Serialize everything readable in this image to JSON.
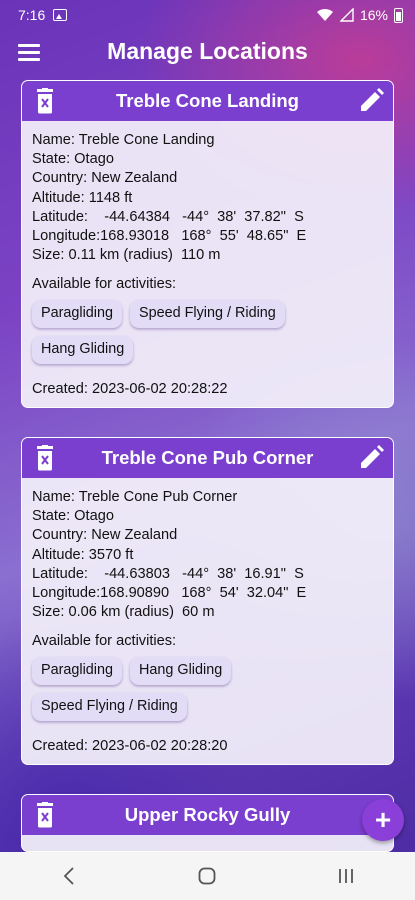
{
  "status_bar": {
    "time": "7:16",
    "battery": "16%"
  },
  "app_bar": {
    "title": "Manage Locations"
  },
  "locations": [
    {
      "title": "Treble Cone Landing",
      "name_line": "Name: Treble Cone Landing",
      "state_line": "State: Otago",
      "country_line": "Country: New Zealand",
      "altitude_line": "Altitude: 1148 ft",
      "latitude_line": "Latitude:    -44.64384   -44°  38'  37.82\"  S",
      "longitude_line": "Longitude:168.93018   168°  55'  48.65\"  E",
      "size_line": "Size: 0.11 km (radius)  110 m",
      "activities_label": "Available for activities:",
      "activities": [
        "Paragliding",
        "Speed Flying / Riding",
        "Hang Gliding"
      ],
      "created_line": "Created: 2023-06-02  20:28:22"
    },
    {
      "title": "Treble Cone Pub Corner",
      "name_line": "Name: Treble Cone Pub Corner",
      "state_line": "State: Otago",
      "country_line": "Country: New Zealand",
      "altitude_line": "Altitude: 3570 ft",
      "latitude_line": "Latitude:    -44.63803   -44°  38'  16.91\"  S",
      "longitude_line": "Longitude:168.90890   168°  54'  32.04\"  E",
      "size_line": "Size: 0.06 km (radius)  60 m",
      "activities_label": "Available for activities:",
      "activities": [
        "Paragliding",
        "Hang Gliding",
        "Speed Flying / Riding"
      ],
      "created_line": "Created: 2023-06-02  20:28:20"
    },
    {
      "title": "Upper Rocky Gully"
    }
  ],
  "colors": {
    "header": "#7b3fd0",
    "chip": "#e3dcf6",
    "fab": "#8a3fd8"
  }
}
